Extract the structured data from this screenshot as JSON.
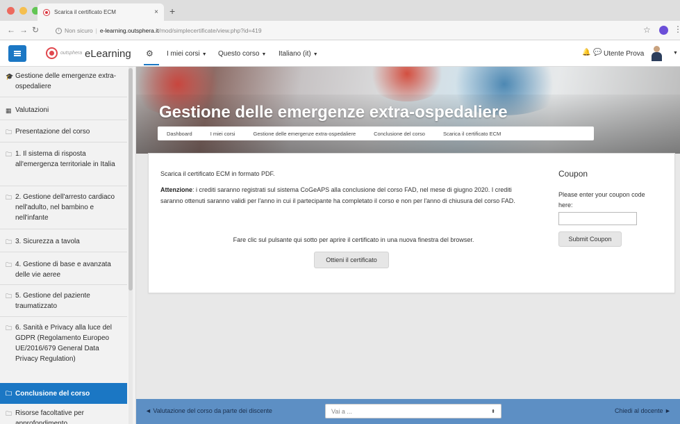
{
  "browser": {
    "tab_title": "Scarica il certificato ECM",
    "tab_close": "×",
    "new_tab": "+",
    "url_prefix": "Non sicuro",
    "url_host": "e-learning.outsphera.it",
    "url_path": "/mod/simplecertificate/view.php?id=419",
    "traffic_light_colors": [
      "#ed6a5e",
      "#f5bf4f",
      "#62c554"
    ]
  },
  "navbar": {
    "logo_small_text": "outsphera",
    "brand": "eLearning",
    "menus": [
      {
        "label": "I miei corsi",
        "caret": "▼"
      },
      {
        "label": "Questo corso",
        "caret": "▼"
      },
      {
        "label": "Italiano (it)",
        "caret": "▼"
      }
    ],
    "user_name": "Utente Prova",
    "accent_color": "#1b77c4"
  },
  "sidebar": {
    "items": [
      {
        "icon": "🎓",
        "label": "Gestione delle emergenze extra-ospedaliere"
      },
      {
        "icon": "▦",
        "label": "Valutazioni"
      },
      {
        "icon": "🗀",
        "label": "Presentazione del corso"
      },
      {
        "icon": "🗀",
        "label": "1. Il sistema di risposta all'emergenza territoriale in Italia"
      },
      {
        "icon": "🗀",
        "label": "2. Gestione dell'arresto cardiaco nell'adulto, nel bambino e nell'infante"
      },
      {
        "icon": "🗀",
        "label": "3. Sicurezza a tavola"
      },
      {
        "icon": "🗀",
        "label": "4. Gestione di base e avanzata delle vie aeree"
      },
      {
        "icon": "🗀",
        "label": "5. Gestione del paziente traumatizzato"
      },
      {
        "icon": "🗀",
        "label": "6. Sanità e Privacy alla luce del GDPR (Regolamento Europeo UE/2016/679 General Data Privacy Regulation)"
      },
      {
        "icon": "🗀",
        "label": "Conclusione del corso"
      },
      {
        "icon": "🗀",
        "label": "Risorse facoltative per approfondimento"
      }
    ]
  },
  "page": {
    "title": "Gestione delle emergenze extra-ospedaliere",
    "breadcrumbs": [
      "Dashboard",
      "I miei corsi",
      "Gestione delle emergenze extra-ospedaliere",
      "Conclusione del corso",
      "Scarica il certificato ECM"
    ]
  },
  "certificate": {
    "intro": "Scarica il certificato ECM in formato PDF.",
    "warning_label": "Attenzione",
    "warning_text": ": i crediti saranno registrati sul sistema CoGeAPS alla conclusione del corso FAD, nel mese di giugno 2020. I crediti saranno ottenuti saranno validi per l'anno in cui il partecipante ha completato il corso e non per l'anno di chiusura del corso FAD.",
    "instruction": "Fare clic sul pulsante qui sotto per aprire il certificato in una nuova finestra del browser.",
    "button_label": "Ottieni il certificato"
  },
  "coupon": {
    "title": "Coupon",
    "hint": "Please enter your coupon code here:",
    "input_value": "",
    "button_label": "Submit Coupon"
  },
  "footer": {
    "prev_label": "◄ Valutazione del corso da parte dei discente",
    "jump_placeholder": "Vai a ...",
    "next_label": "Chiedi al docente ►",
    "bar_color": "#5d8fc4"
  }
}
